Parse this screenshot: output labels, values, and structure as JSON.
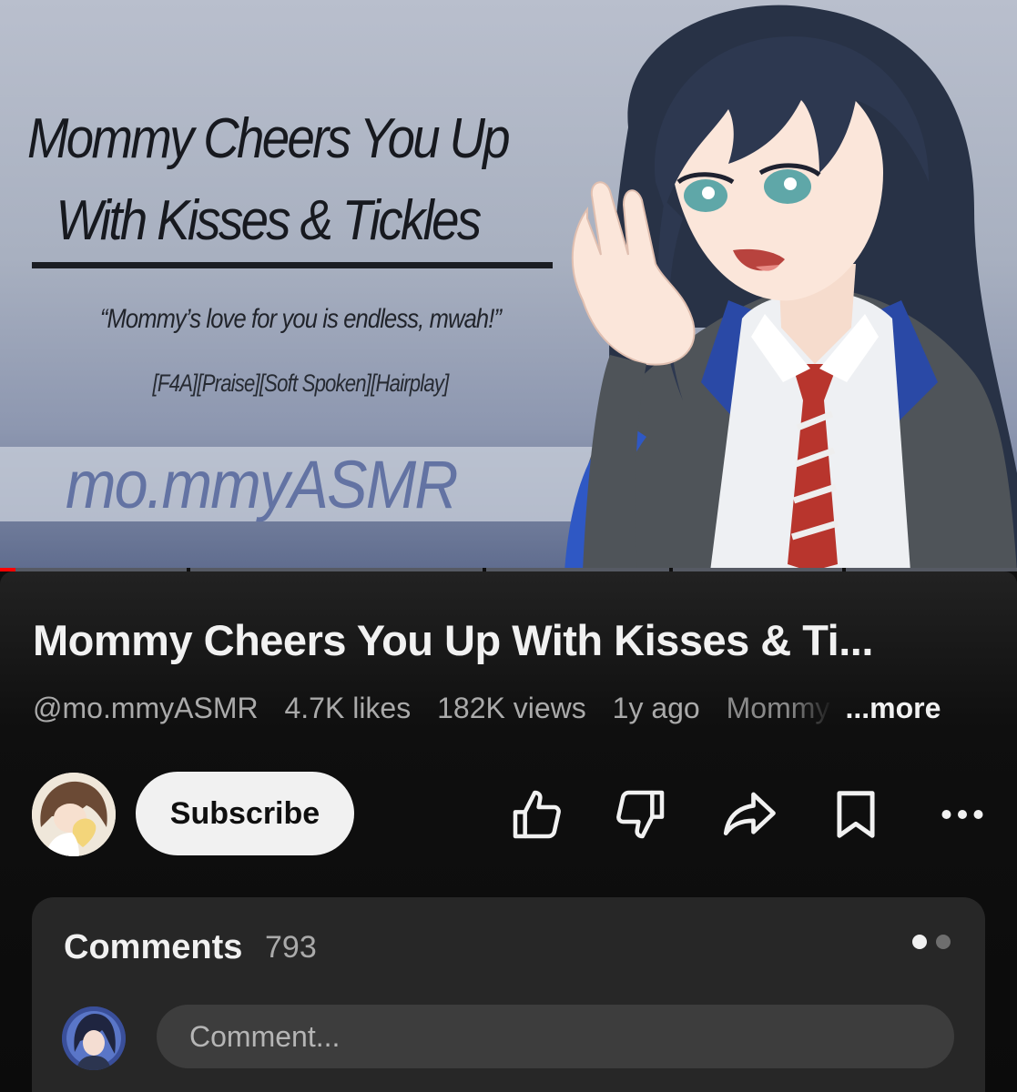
{
  "thumbnail": {
    "title_text": "Mommy Cheers You Up\nWith Kisses & Tickles",
    "quote_text": "“Mommy’s love for you is endless, mwah!”",
    "tags_text": "[F4A][Praise][Soft Spoken][Hairplay]",
    "channel_text": "mo.mmyASMR"
  },
  "player": {
    "progress": 0.015
  },
  "video": {
    "title": "Mommy Cheers You Up With Kisses & Ti...",
    "handle": "@mo.mmyASMR",
    "likes": "4.7K likes",
    "views": "182K views",
    "age": "1y ago",
    "description_preview": "Mommy",
    "more_label": "...more"
  },
  "channel": {
    "subscribe_label": "Subscribe"
  },
  "actions": [
    {
      "name": "like-icon"
    },
    {
      "name": "dislike-icon"
    },
    {
      "name": "share-icon"
    },
    {
      "name": "save-icon"
    },
    {
      "name": "more-options-icon"
    }
  ],
  "comments": {
    "heading": "Comments",
    "count": "793",
    "placeholder": "Comment..."
  },
  "colors": {
    "background": "#0f0f0f",
    "card": "#272727",
    "text": "#f1f1f1",
    "muted": "#aaaaaa",
    "progress": "#ff0000"
  }
}
